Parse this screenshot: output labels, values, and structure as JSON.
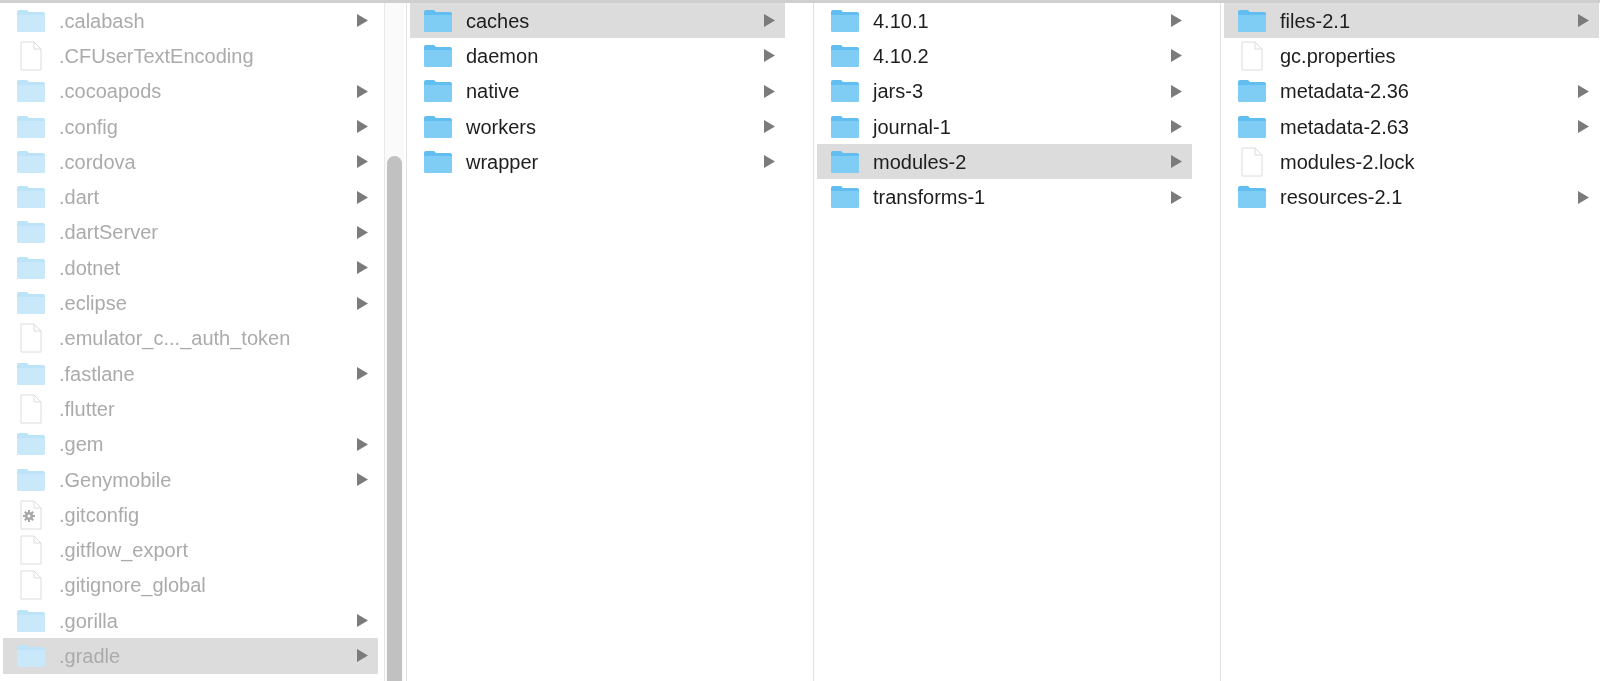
{
  "columns": [
    {
      "items": [
        {
          "name": ".calabash",
          "kind": "folder",
          "hidden": true,
          "selected": false
        },
        {
          "name": ".CFUserTextEncoding",
          "kind": "file",
          "hidden": true,
          "selected": false
        },
        {
          "name": ".cocoapods",
          "kind": "folder",
          "hidden": true,
          "selected": false
        },
        {
          "name": ".config",
          "kind": "folder",
          "hidden": true,
          "selected": false
        },
        {
          "name": ".cordova",
          "kind": "folder",
          "hidden": true,
          "selected": false
        },
        {
          "name": ".dart",
          "kind": "folder",
          "hidden": true,
          "selected": false
        },
        {
          "name": ".dartServer",
          "kind": "folder",
          "hidden": true,
          "selected": false
        },
        {
          "name": ".dotnet",
          "kind": "folder",
          "hidden": true,
          "selected": false
        },
        {
          "name": ".eclipse",
          "kind": "folder",
          "hidden": true,
          "selected": false
        },
        {
          "name": ".emulator_c..._auth_token",
          "kind": "file",
          "hidden": true,
          "selected": false
        },
        {
          "name": ".fastlane",
          "kind": "folder",
          "hidden": true,
          "selected": false
        },
        {
          "name": ".flutter",
          "kind": "file",
          "hidden": true,
          "selected": false
        },
        {
          "name": ".gem",
          "kind": "folder",
          "hidden": true,
          "selected": false
        },
        {
          "name": ".Genymobile",
          "kind": "folder",
          "hidden": true,
          "selected": false
        },
        {
          "name": ".gitconfig",
          "kind": "config",
          "hidden": true,
          "selected": false
        },
        {
          "name": ".gitflow_export",
          "kind": "file",
          "hidden": true,
          "selected": false
        },
        {
          "name": ".gitignore_global",
          "kind": "file",
          "hidden": true,
          "selected": false
        },
        {
          "name": ".gorilla",
          "kind": "folder",
          "hidden": true,
          "selected": false
        },
        {
          "name": ".gradle",
          "kind": "folder",
          "hidden": true,
          "selected": true
        }
      ]
    },
    {
      "items": [
        {
          "name": "caches",
          "kind": "folder",
          "hidden": false,
          "selected": true
        },
        {
          "name": "daemon",
          "kind": "folder",
          "hidden": false,
          "selected": false
        },
        {
          "name": "native",
          "kind": "folder",
          "hidden": false,
          "selected": false
        },
        {
          "name": "workers",
          "kind": "folder",
          "hidden": false,
          "selected": false
        },
        {
          "name": "wrapper",
          "kind": "folder",
          "hidden": false,
          "selected": false
        }
      ]
    },
    {
      "items": [
        {
          "name": "4.10.1",
          "kind": "folder",
          "hidden": false,
          "selected": false
        },
        {
          "name": "4.10.2",
          "kind": "folder",
          "hidden": false,
          "selected": false
        },
        {
          "name": "jars-3",
          "kind": "folder",
          "hidden": false,
          "selected": false
        },
        {
          "name": "journal-1",
          "kind": "folder",
          "hidden": false,
          "selected": false
        },
        {
          "name": "modules-2",
          "kind": "folder",
          "hidden": false,
          "selected": true
        },
        {
          "name": "transforms-1",
          "kind": "folder",
          "hidden": false,
          "selected": false
        }
      ]
    },
    {
      "items": [
        {
          "name": "files-2.1",
          "kind": "folder",
          "hidden": false,
          "selected": true
        },
        {
          "name": "gc.properties",
          "kind": "file",
          "hidden": false,
          "selected": false
        },
        {
          "name": "metadata-2.36",
          "kind": "folder",
          "hidden": false,
          "selected": false
        },
        {
          "name": "metadata-2.63",
          "kind": "folder",
          "hidden": false,
          "selected": false
        },
        {
          "name": "modules-2.lock",
          "kind": "file",
          "hidden": false,
          "selected": false
        },
        {
          "name": "resources-2.1",
          "kind": "folder",
          "hidden": false,
          "selected": false
        }
      ]
    }
  ]
}
